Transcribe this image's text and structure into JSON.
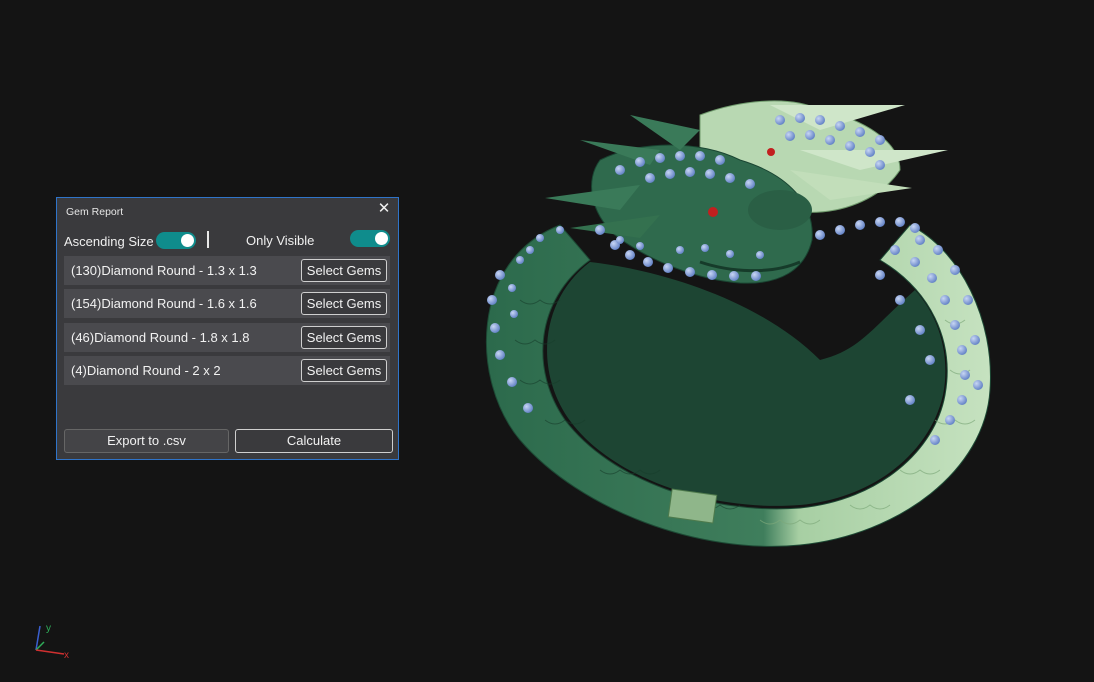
{
  "panel": {
    "title": "Gem Report",
    "close_glyph": "✕",
    "ascending_label": "Ascending Size",
    "ascending_on": true,
    "visible_label": "Only Visible",
    "visible_on": true,
    "rows": [
      {
        "label": "(130)Diamond Round - 1.3 x 1.3",
        "button": "Select Gems"
      },
      {
        "label": "(154)Diamond Round - 1.6 x 1.6",
        "button": "Select Gems"
      },
      {
        "label": "(46)Diamond Round - 1.8 x 1.8",
        "button": "Select Gems"
      },
      {
        "label": "(4)Diamond Round - 2 x 2",
        "button": "Select Gems"
      }
    ],
    "export_label": "Export to .csv",
    "calculate_label": "Calculate"
  },
  "gizmo": {
    "x_label": "x",
    "y_label": "y"
  },
  "colors": {
    "background": "#141414",
    "dark_green": "#2f6a4d",
    "light_green": "#b4d6b0",
    "gem_blue": "#7f9bd6",
    "toggle_teal": "#0f8c8c",
    "panel_border": "#2f74c9"
  }
}
